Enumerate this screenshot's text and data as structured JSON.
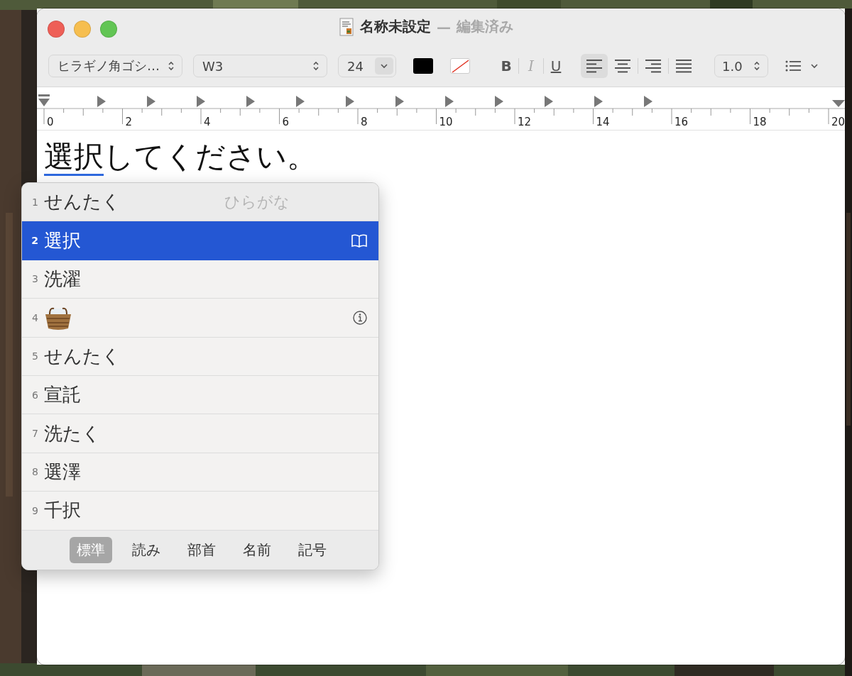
{
  "window": {
    "title": "名称未設定",
    "separator": "—",
    "status": "編集済み"
  },
  "toolbar": {
    "font_family": "ヒラギノ角ゴシ…",
    "typeface": "W3",
    "font_size": "24",
    "style_buttons": [
      {
        "label": "B",
        "kind": "bold"
      },
      {
        "label": "I",
        "kind": "italic"
      },
      {
        "label": "U",
        "kind": "underline"
      }
    ],
    "alignment": [
      {
        "kind": "left",
        "selected": true
      },
      {
        "kind": "center",
        "selected": false
      },
      {
        "kind": "right",
        "selected": false
      },
      {
        "kind": "justify",
        "selected": false
      }
    ],
    "line_spacing": "1.0"
  },
  "ruler": {
    "labels": [
      "0",
      "2",
      "4",
      "6",
      "8",
      "10",
      "12",
      "14",
      "16",
      "18",
      "20"
    ]
  },
  "document": {
    "segments": [
      {
        "text": "選択",
        "kind": "converting"
      },
      {
        "text": "してください。",
        "kind": "plain"
      }
    ]
  },
  "candidates": {
    "rows": [
      {
        "number": "1",
        "text": "せんたく",
        "note": "ひらがな",
        "kind": "text",
        "dictionary": false,
        "info": false,
        "selected": false
      },
      {
        "number": "2",
        "text": "選択",
        "kind": "text",
        "dictionary": true,
        "info": false,
        "selected": true
      },
      {
        "number": "3",
        "text": "洗濯",
        "kind": "text",
        "dictionary": false,
        "info": false,
        "selected": false
      },
      {
        "number": "4",
        "kind": "emoji",
        "dictionary": false,
        "info": true,
        "selected": false
      },
      {
        "number": "5",
        "text": "せんたく",
        "kind": "text",
        "dictionary": false,
        "info": false,
        "selected": false
      },
      {
        "number": "6",
        "text": "宣託",
        "kind": "text",
        "dictionary": false,
        "info": false,
        "selected": false
      },
      {
        "number": "7",
        "text": "洗たく",
        "kind": "text",
        "dictionary": false,
        "info": false,
        "selected": false
      },
      {
        "number": "8",
        "text": "選澤",
        "kind": "text",
        "dictionary": false,
        "info": false,
        "selected": false
      },
      {
        "number": "9",
        "text": "千択",
        "kind": "text",
        "dictionary": false,
        "info": false,
        "selected": false
      }
    ],
    "tabs": [
      {
        "label": "標準",
        "selected": true
      },
      {
        "label": "読み",
        "selected": false
      },
      {
        "label": "部首",
        "selected": false
      },
      {
        "label": "名前",
        "selected": false
      },
      {
        "label": "記号",
        "selected": false
      }
    ]
  }
}
